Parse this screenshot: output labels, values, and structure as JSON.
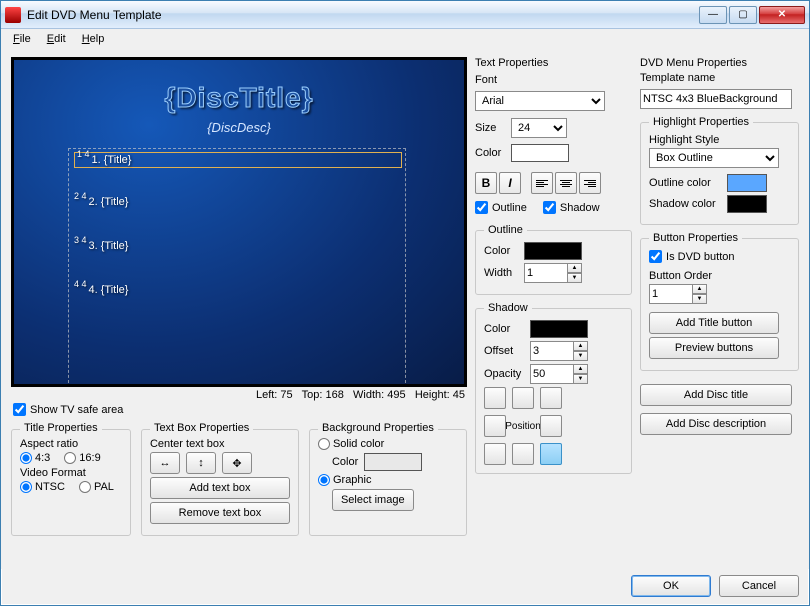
{
  "window": {
    "title": "Edit DVD Menu Template"
  },
  "menu": {
    "file": "File",
    "edit": "Edit",
    "help": "Help"
  },
  "preview": {
    "disc_title": "{DiscTitle}",
    "disc_desc": "{DiscDesc}",
    "title1": "1. {Title}",
    "title2": "2. {Title}",
    "title3": "3. {Title}",
    "title4": "4. {Title}",
    "nums1": "1\n4",
    "nums2": "2\n4",
    "nums3": "3\n4",
    "nums4": "4\n4"
  },
  "status": {
    "left_lbl": "Left:",
    "left": "75",
    "top_lbl": "Top:",
    "top": "168",
    "width_lbl": "Width:",
    "width": "495",
    "height_lbl": "Height:",
    "height": "45"
  },
  "safe": {
    "label": "Show TV safe area",
    "checked": true
  },
  "title_props": {
    "legend": "Title Properties",
    "aspect_label": "Aspect ratio",
    "a43": "4:3",
    "a169": "16:9",
    "video_label": "Video Format",
    "ntsc": "NTSC",
    "pal": "PAL"
  },
  "textbox_props": {
    "legend": "Text Box Properties",
    "center_label": "Center text box",
    "add": "Add text box",
    "remove": "Remove text box"
  },
  "bg_props": {
    "legend": "Background Properties",
    "solid": "Solid color",
    "color_lbl": "Color",
    "graphic": "Graphic",
    "select_img": "Select image"
  },
  "text_props": {
    "header": "Text Properties",
    "font_lbl": "Font",
    "font": "Arial",
    "size_lbl": "Size",
    "size": "24",
    "color_lbl": "Color",
    "outline_chk": "Outline",
    "shadow_chk": "Shadow",
    "outline": {
      "legend": "Outline",
      "color_lbl": "Color",
      "width_lbl": "Width",
      "width": "1"
    },
    "shadow": {
      "legend": "Shadow",
      "color_lbl": "Color",
      "offset_lbl": "Offset",
      "offset": "3",
      "opacity_lbl": "Opacity",
      "opacity": "50",
      "position_lbl": "Position"
    },
    "colors": {
      "text": "#ffffff",
      "outline": "#000000",
      "shadow": "#000000"
    }
  },
  "dvd_props": {
    "header": "DVD Menu Properties",
    "template_lbl": "Template name",
    "template": "NTSC 4x3 BlueBackground",
    "highlight": {
      "legend": "Highlight Properties",
      "style_lbl": "Highlight Style",
      "style": "Box Outline",
      "outline_lbl": "Outline color",
      "outline_color": "#5aa7ff",
      "shadow_lbl": "Shadow color",
      "shadow_color": "#000000"
    },
    "button": {
      "legend": "Button Properties",
      "is_dvd": "Is DVD button",
      "order_lbl": "Button Order",
      "order": "1",
      "add_title": "Add Title button",
      "preview": "Preview buttons"
    },
    "add_disc_title": "Add Disc title",
    "add_disc_desc": "Add Disc description"
  },
  "footer": {
    "ok": "OK",
    "cancel": "Cancel"
  }
}
